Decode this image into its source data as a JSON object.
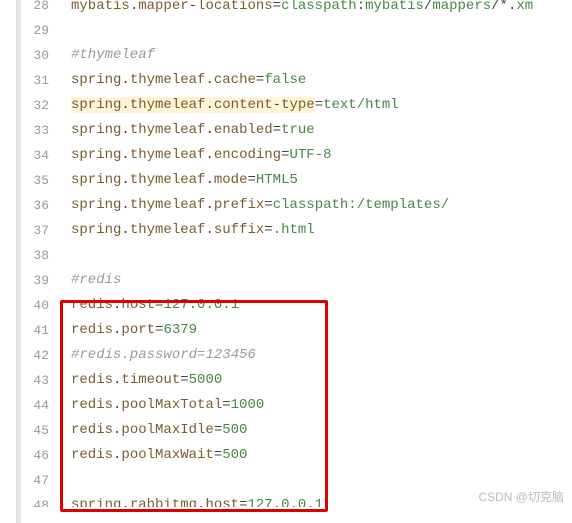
{
  "gutter_start": 28,
  "top_partial": {
    "a": "mybatis",
    "b": "mapper",
    "c": "locations",
    "d": "classpath",
    "e": "mybatis",
    "f": "mappers",
    "g": "xm"
  },
  "lines": [
    {
      "type": "blank"
    },
    {
      "type": "comment",
      "text": "#thymeleaf"
    },
    {
      "type": "kv",
      "key": "spring.thymeleaf.cache",
      "val": "false",
      "hl": false
    },
    {
      "type": "kv",
      "key": "spring.thymeleaf.content-type",
      "val": "text/html",
      "hl": true
    },
    {
      "type": "kv",
      "key": "spring.thymeleaf.enabled",
      "val": "true",
      "hl": false
    },
    {
      "type": "kv",
      "key": "spring.thymeleaf.encoding",
      "val": "UTF-8",
      "hl": false
    },
    {
      "type": "kv",
      "key": "spring.thymeleaf.mode",
      "val": "HTML5",
      "hl": false
    },
    {
      "type": "kv",
      "key": "spring.thymeleaf.prefix",
      "val": "classpath:/templates/",
      "hl": false
    },
    {
      "type": "kv",
      "key": "spring.thymeleaf.suffix",
      "val": ".html",
      "hl": false
    },
    {
      "type": "blank"
    },
    {
      "type": "comment",
      "text": "#redis"
    },
    {
      "type": "kv",
      "key": "redis.host",
      "val": "127.0.0.1",
      "hl": false
    },
    {
      "type": "kv",
      "key": "redis.port",
      "val": "6379",
      "hl": false
    },
    {
      "type": "comment",
      "text": "#redis.password=123456"
    },
    {
      "type": "kv",
      "key": "redis.timeout",
      "val": "5000",
      "hl": false
    },
    {
      "type": "kv",
      "key": "redis.poolMaxTotal",
      "val": "1000",
      "hl": false
    },
    {
      "type": "kv",
      "key": "redis.poolMaxIdle",
      "val": "500",
      "hl": false
    },
    {
      "type": "kv",
      "key": "redis.poolMaxWait",
      "val": "500",
      "hl": false
    },
    {
      "type": "blank"
    },
    {
      "type": "kv",
      "key": "spring.rabbitmq.host",
      "val": "127.0.0.1",
      "hl": false,
      "partial": true
    }
  ],
  "sep_dot": ".",
  "sep_dash": "-",
  "sep_colon": ":",
  "sep_slash": "/",
  "sep_star": "*",
  "eq": "=",
  "watermark": "CSDN @切克脑"
}
